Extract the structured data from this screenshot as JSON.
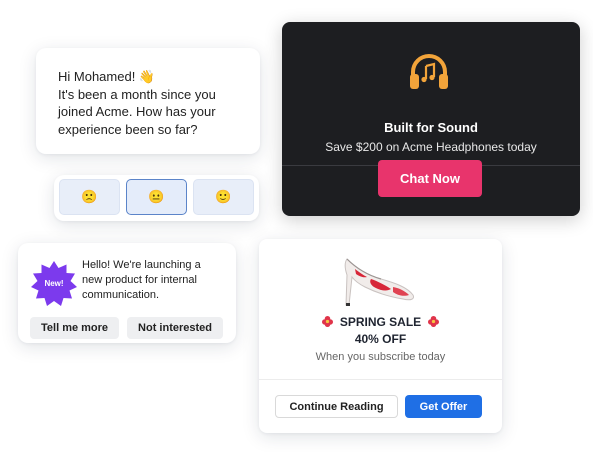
{
  "greeting_card": {
    "hello": "Hi Mohamed! 👋",
    "body": "It's been a month since you\njoined Acme. How has your\nexperience been so far?"
  },
  "rating": {
    "options": [
      {
        "emoji": "🙁",
        "selected": false
      },
      {
        "emoji": "😐",
        "selected": true
      },
      {
        "emoji": "🙂",
        "selected": false
      }
    ]
  },
  "new_product_card": {
    "badge": "New!",
    "text": "Hello! We're launching a\nnew product for internal\ncommunication.",
    "tell_more": "Tell me more",
    "not_interested": "Not interested"
  },
  "sound_card": {
    "icon": "headphones-icon",
    "title": "Built for Sound",
    "subtitle": "Save $200 on Acme Headphones today",
    "cta": "Chat Now"
  },
  "sale_card": {
    "image": "high-heel-shoe",
    "title": "SPRING SALE",
    "discount": "40% OFF",
    "note": "When you subscribe today",
    "continue": "Continue Reading",
    "offer": "Get Offer"
  },
  "colors": {
    "dark_card": "#1d1e21",
    "chat_button": "#e8346c",
    "headphones": "#f2a43a",
    "badge": "#7c3aed",
    "offer_button": "#1f6fe5"
  }
}
